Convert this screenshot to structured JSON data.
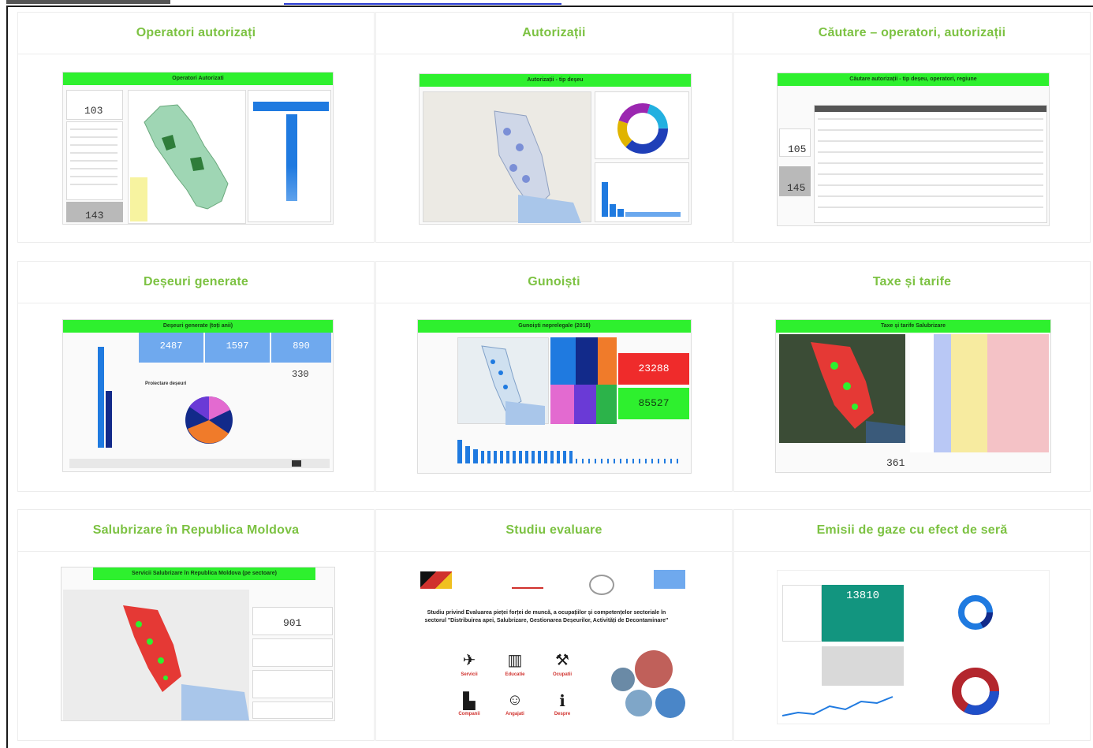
{
  "cards": [
    {
      "title": "Operatori autorizați",
      "thumb_title": "Operatori Autorizati",
      "kpis": [
        "103",
        "143"
      ]
    },
    {
      "title": "Autorizații",
      "thumb_title": "Autorizații - tip deșeu"
    },
    {
      "title": "Căutare – operatori, autorizații",
      "thumb_title": "Căutare autorizații - tip deșeu, operatori, regiune",
      "kpis": [
        "105",
        "145"
      ]
    },
    {
      "title": "Deșeuri generate",
      "thumb_title": "Deșeuri generate (toți anii)",
      "kpis": [
        "2487",
        "1597",
        "890",
        "330"
      ],
      "pie_title": "Proiectare deșeuri"
    },
    {
      "title": "Gunoiști",
      "thumb_title": "Gunoiști neprelegale (2018)",
      "kpis": [
        "23288",
        "85527"
      ]
    },
    {
      "title": "Taxe și tarife",
      "thumb_title": "Taxe și tarife Salubrizare",
      "kpis": [
        "361"
      ]
    },
    {
      "title": "Salubrizare în Republica Moldova",
      "thumb_title": "Servicii Salubrizare în Republica Moldova (pe sectoare)",
      "kpis": [
        "901"
      ]
    },
    {
      "title": "Studiu evaluare",
      "study_text": "Studiu privind Evaluarea pieței forței de muncă, a ocupațiilor și competențelor sectoriale în sectorul \"Distribuirea apei, Salubrizare, Gestionarea Deșeurilor, Activități de Decontaminare\"",
      "icons": [
        {
          "name": "Servicii",
          "glyph": "✈"
        },
        {
          "name": "Educatie",
          "glyph": "▥"
        },
        {
          "name": "Ocupatii",
          "glyph": "⚒"
        },
        {
          "name": "Companii",
          "glyph": "▙"
        },
        {
          "name": "Angajati",
          "glyph": "☺"
        },
        {
          "name": "Despre",
          "glyph": "ℹ"
        }
      ]
    },
    {
      "title": "Emisii de gaze cu efect de seră",
      "kpis": [
        "13810"
      ]
    }
  ],
  "colors": {
    "accent_green": "#7cc242",
    "thumb_green": "#2ef02e",
    "blue": "#1f7ae0",
    "red": "#e53935"
  }
}
